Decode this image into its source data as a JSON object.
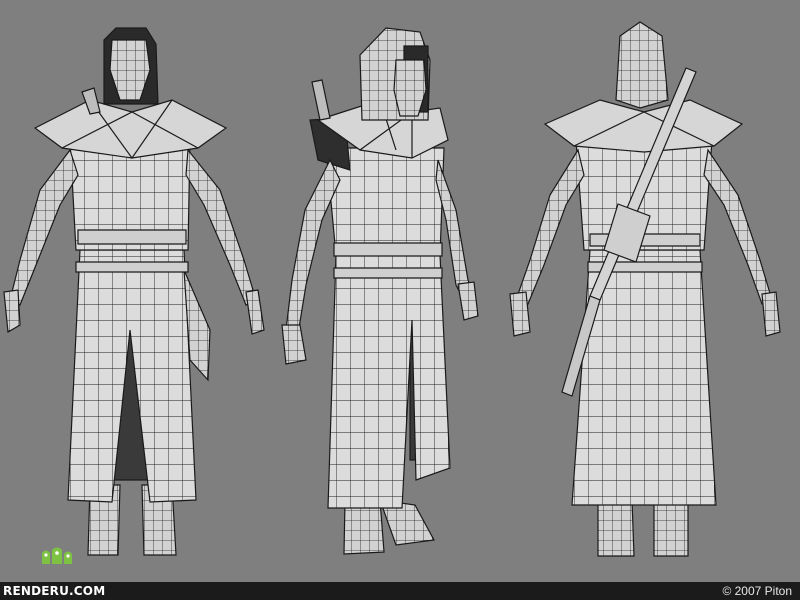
{
  "footer": {
    "logo_text": "RENDERU.COM",
    "copyright": "© 2007 Piton"
  },
  "scene": {
    "views": [
      "front",
      "three-quarter",
      "back"
    ],
    "colors": {
      "background": "#7f7f7f",
      "model_fill": "#d9d9d9",
      "wire": "#1a1a1a",
      "logo_green": "#7dc242",
      "footer_bar": "#1b1b1b"
    }
  }
}
